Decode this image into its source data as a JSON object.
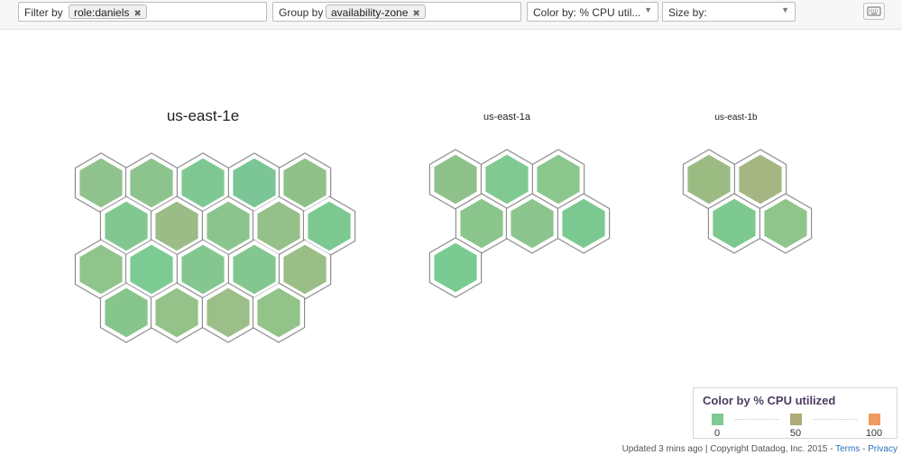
{
  "toolbar": {
    "filter": {
      "label": "Filter by",
      "chip": "role:daniels"
    },
    "group": {
      "label": "Group by",
      "chip": "availability-zone"
    },
    "color_by": "Color by: % CPU util...",
    "size_by": "Size by:"
  },
  "zones": [
    {
      "name": "us-east-1e",
      "host_colors": [
        "#8fc28c",
        "#8dc48d",
        "#80c893",
        "#7cc596",
        "#8fc189",
        "#82c78f",
        "#9bbb87",
        "#8cc48d",
        "#95c089",
        "#7dc891",
        "#8fc48b",
        "#7ccb93",
        "#84c68f",
        "#84c690",
        "#9bbd86",
        "#86c58c",
        "#94c288",
        "#9cbf89",
        "#92c388"
      ]
    },
    {
      "name": "us-east-1a",
      "host_colors": [
        "#8fc28b",
        "#80c991",
        "#8bc68d",
        "#8ac58b",
        "#8cc48d",
        "#7bc991",
        "#7acb92"
      ]
    },
    {
      "name": "us-east-1b",
      "host_colors": [
        "#9bbb83",
        "#a6b683",
        "#7dc98f",
        "#8fc58b"
      ]
    }
  ],
  "legend": {
    "title": "Color by % CPU utilized",
    "stops": [
      {
        "label": "0",
        "color": "#7fc993"
      },
      {
        "label": "50",
        "color": "#b0ab78"
      },
      {
        "label": "100",
        "color": "#f19a5f"
      }
    ]
  },
  "footer": {
    "updated": "Updated 3 mins ago",
    "copyright": "Copyright Datadog, Inc. 2015",
    "terms": "Terms",
    "privacy": "Privacy"
  }
}
